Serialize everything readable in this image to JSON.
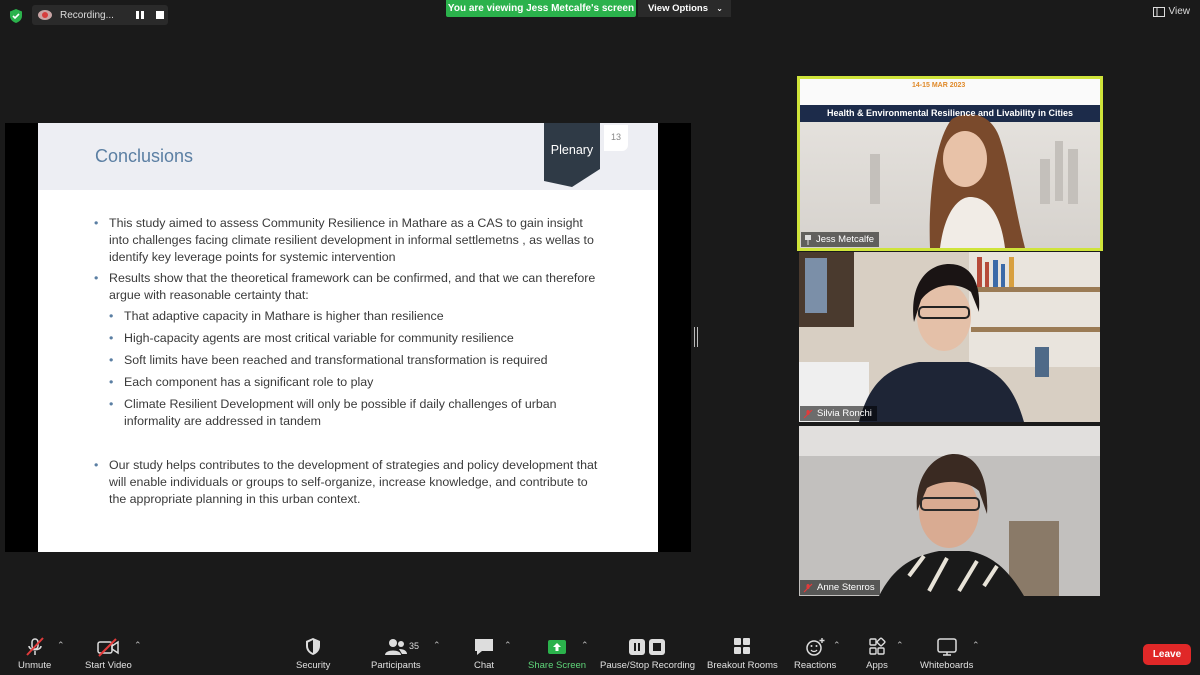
{
  "recording": {
    "label": "Recording..."
  },
  "banner": {
    "viewing": "You are viewing Jess Metcalfe's screen",
    "view_options": "View Options"
  },
  "view_button": "View",
  "slide": {
    "title": "Conclusions",
    "tag": "Plenary",
    "page_number": "13",
    "bullets": [
      "This study aimed to assess Community Resilience in Mathare as a CAS to gain insight into challenges facing climate resilient development in informal settlemetns , as wellas to identify key leverage points for systemic intervention",
      "Results show that the theoretical framework can be confirmed, and that we can therefore argue with reasonable certainty that:"
    ],
    "sub_bullets": [
      "That adaptive capacity in Mathare is higher than resilience",
      "High-capacity agents are most critical variable for community resilience",
      "Soft limits have been reached and transformational transformation is required",
      "Each component has a significant role to play",
      "Climate Resilient Development will only be possible if daily challenges of urban informality are addressed in tandem"
    ],
    "final_bullet": "Our study helps contributes to the development of strategies and policy development that will enable individuals or groups to self-organize, increase knowledge, and contribute to the appropriate planning in this urban context."
  },
  "participants_tiles": [
    {
      "name": "Jess Metcalfe",
      "banner": "Health & Environmental Resilience and Livability in Cities",
      "dates": "14-15  MAR  2023"
    },
    {
      "name": "Silvia Ronchi"
    },
    {
      "name": "Anne Stenros"
    }
  ],
  "toolbar": {
    "unmute": "Unmute",
    "start_video": "Start Video",
    "security": "Security",
    "participants": "Participants",
    "participants_count": "35",
    "chat": "Chat",
    "share_screen": "Share Screen",
    "pause_recording": "Pause/Stop Recording",
    "breakout_rooms": "Breakout Rooms",
    "reactions": "Reactions",
    "apps": "Apps",
    "whiteboards": "Whiteboards",
    "leave": "Leave"
  },
  "colors": {
    "accent_green": "#2bb24c",
    "speaker_border": "#cfe43a",
    "leave_red": "#e02828",
    "slide_title": "#5b7fa3"
  }
}
